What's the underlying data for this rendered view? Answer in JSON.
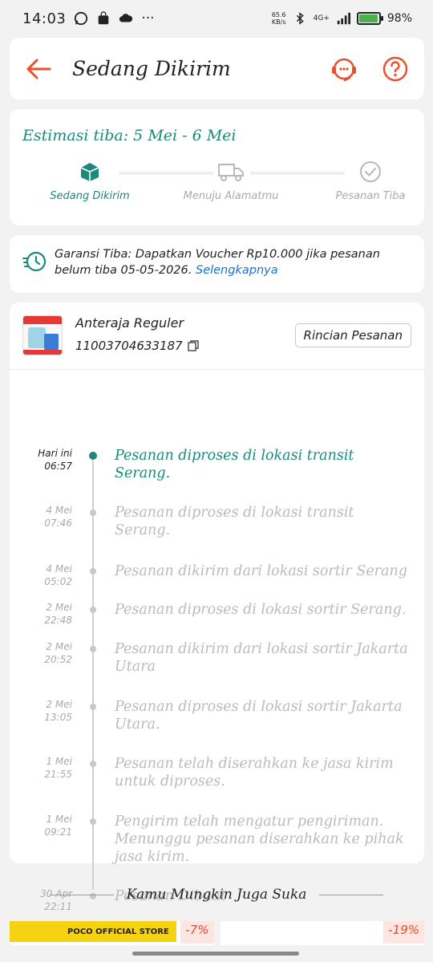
{
  "status_bar": {
    "time": "14:03",
    "speed": "65.6\nKB/s",
    "network": "4G+",
    "battery": "98%"
  },
  "header": {
    "title": "Sedang Dikirim"
  },
  "estimation": {
    "title": "Estimasi tiba: 5 Mei - 6 Mei",
    "steps": [
      {
        "label": "Sedang Dikirim",
        "active": true
      },
      {
        "label": "Menuju Alamatmu",
        "active": false
      },
      {
        "label": "Pesanan Tiba",
        "active": false
      }
    ]
  },
  "guarantee": {
    "text": "Garansi Tiba: Dapatkan Voucher Rp10.000 jika pesanan belum tiba 05-05-2026.",
    "link": "Selengkapnya"
  },
  "courier": {
    "name": "Anteraja Reguler",
    "resi": "11003704633187",
    "details_button": "Rincian Pesanan"
  },
  "timeline": [
    {
      "date": "Hari ini",
      "time": "06:57",
      "text": "Pesanan diproses di lokasi transit Serang.",
      "active": true
    },
    {
      "date": "4 Mei",
      "time": "07:46",
      "text": "Pesanan diproses di lokasi transit Serang.",
      "active": false
    },
    {
      "date": "4 Mei",
      "time": "05:02",
      "text": "Pesanan dikirim dari lokasi sortir  Serang",
      "active": false
    },
    {
      "date": "2 Mei",
      "time": "22:48",
      "text": "Pesanan diproses di lokasi sortir  Serang.",
      "active": false
    },
    {
      "date": "2 Mei",
      "time": "20:52",
      "text": "Pesanan dikirim dari lokasi sortir Jakarta Utara",
      "active": false
    },
    {
      "date": "2 Mei",
      "time": "13:05",
      "text": "Pesanan diproses di lokasi sortir  Jakarta Utara.",
      "active": false
    },
    {
      "date": "1 Mei",
      "time": "21:55",
      "text": "Pesanan telah diserahkan ke jasa kirim untuk diproses.",
      "active": false
    },
    {
      "date": "1 Mei",
      "time": "09:21",
      "text": "Pengirim telah mengatur pengiriman. Menunggu pesanan diserahkan ke pihak jasa kirim.",
      "active": false
    },
    {
      "date": "30 Apr",
      "time": "22:11",
      "text": "Pesanan Dibuat",
      "active": false
    }
  ],
  "recommendation": {
    "title": "Kamu Mungkin Juga Suka",
    "products": [
      {
        "store": "POCO OFFICIAL STORE",
        "discount": "-7%"
      },
      {
        "store": "",
        "discount": "-19%"
      }
    ]
  },
  "colors": {
    "accent_teal": "#1b8a7a",
    "brand_orange": "#e8502f",
    "link_blue": "#1a6fd1"
  }
}
